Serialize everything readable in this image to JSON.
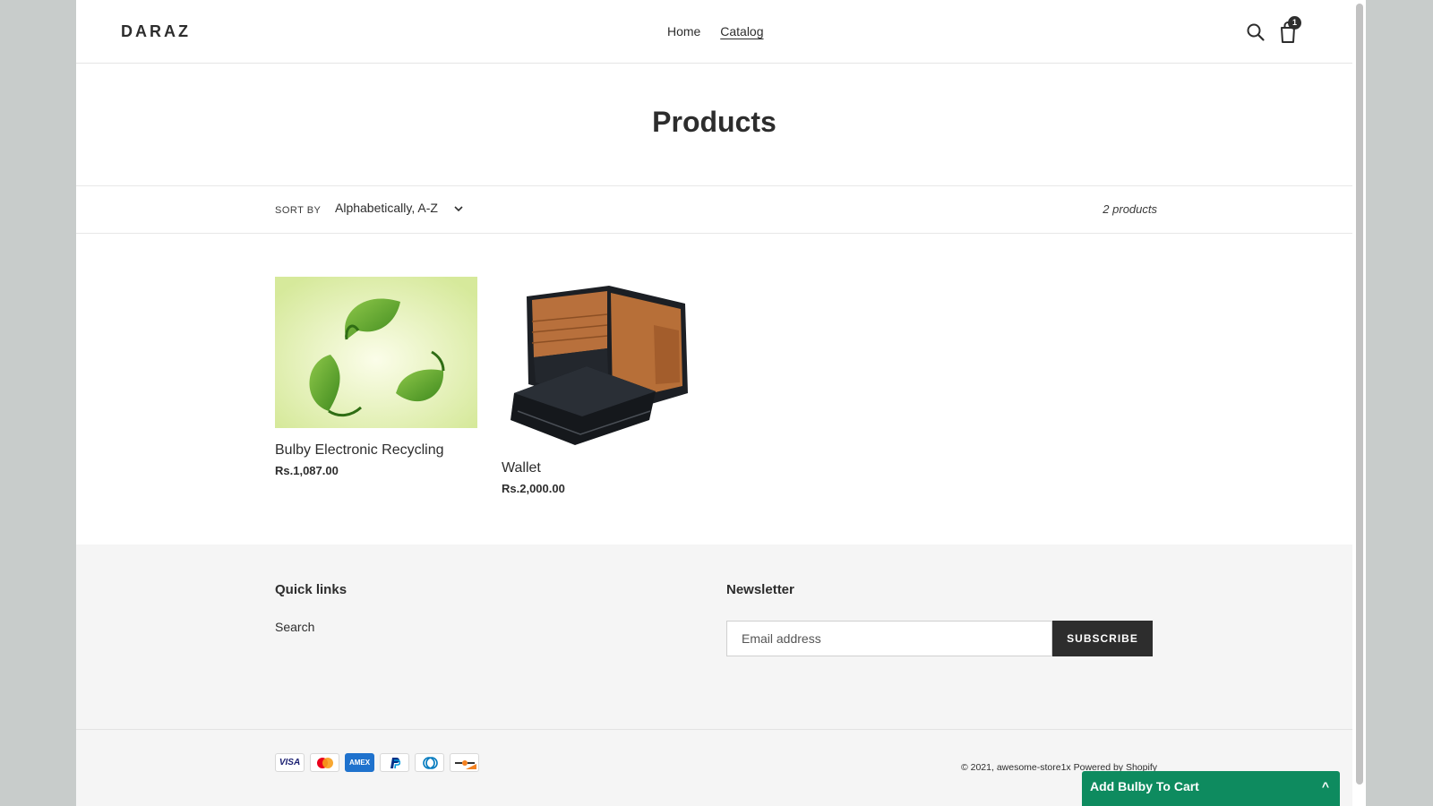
{
  "header": {
    "logo": "DARAZ",
    "nav": [
      {
        "label": "Home",
        "active": false
      },
      {
        "label": "Catalog",
        "active": true
      }
    ],
    "cart_count": "1"
  },
  "collection": {
    "title": "Products",
    "sort_label": "SORT BY",
    "sort_value": "Alphabetically, A-Z",
    "product_count": "2 products"
  },
  "products": [
    {
      "title": "Bulby Electronic Recycling",
      "price": "Rs.1,087.00"
    },
    {
      "title": "Wallet",
      "price": "Rs.2,000.00"
    }
  ],
  "footer": {
    "quick_links_heading": "Quick links",
    "quick_links": [
      "Search"
    ],
    "newsletter_heading": "Newsletter",
    "email_placeholder": "Email address",
    "subscribe_label": "SUBSCRIBE",
    "payment_icons": [
      "visa-icon",
      "mastercard-icon",
      "amex-icon",
      "paypal-icon",
      "diners-club-icon",
      "discover-icon"
    ],
    "payment_text": {
      "visa": "VISA",
      "amex": "AMEX"
    },
    "copyright": "© 2021, awesome-store1x Powered by Shopify"
  },
  "sticky_cart": {
    "label": "Add Bulby To Cart",
    "caret": "^"
  },
  "colors": {
    "accent_green": "#0e8b5f",
    "text_dark": "#2d2d2d",
    "footer_bg": "#f5f5f5"
  }
}
